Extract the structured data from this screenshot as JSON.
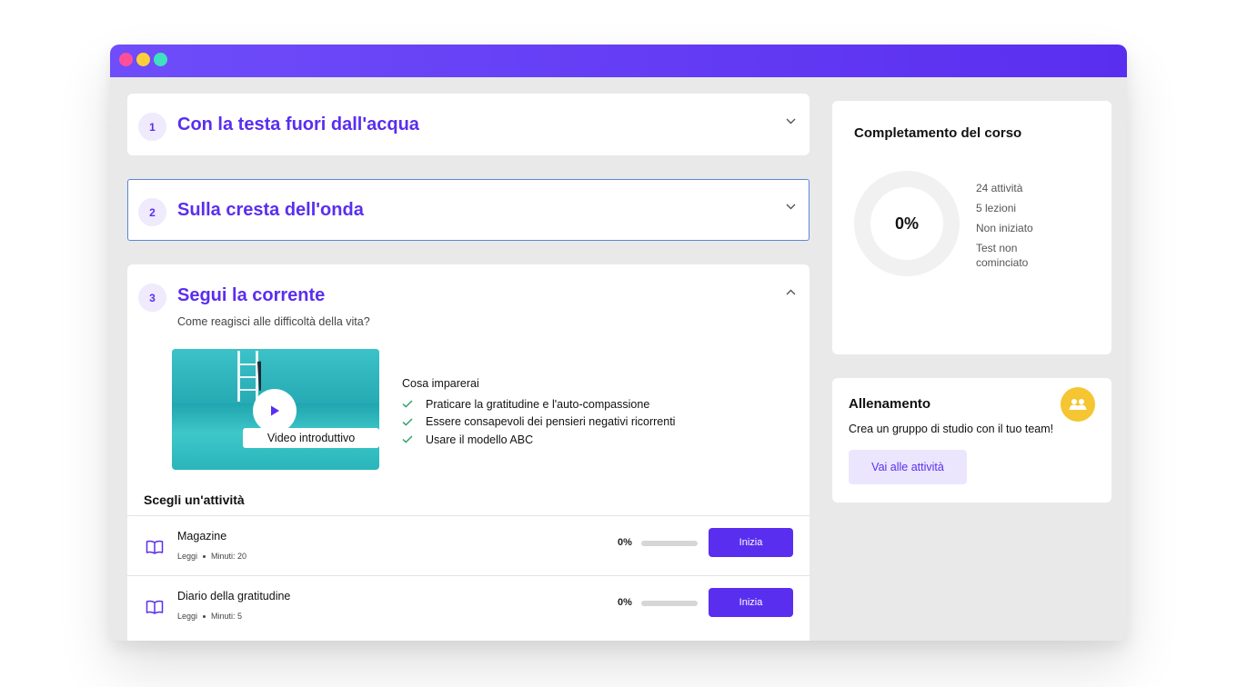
{
  "window": {
    "controls": [
      "close",
      "minimize",
      "maximize"
    ]
  },
  "modules": [
    {
      "number": "1",
      "title": "Con la testa fuori dall'acqua",
      "expanded": false
    },
    {
      "number": "2",
      "title": "Sulla cresta dell'onda",
      "expanded": false,
      "focused": true
    },
    {
      "number": "3",
      "title": "Segui la corrente",
      "subtitle": "Come reagisci alle difficoltà della vita?",
      "expanded": true
    }
  ],
  "video": {
    "caption": "Video introduttivo",
    "icon": "play-icon"
  },
  "learn": {
    "heading": "Cosa imparerai",
    "items": [
      "Praticare la gratitudine e l'auto-compassione",
      "Essere consapevoli dei pensieri negativi ricorrenti",
      "Usare il modello ABC"
    ]
  },
  "activities": {
    "heading": "Scegli un'attività",
    "items": [
      {
        "title": "Magazine",
        "type": "Leggi",
        "minutes": "Minuti: 20",
        "progress_label": "0%",
        "progress": 0,
        "button": "Inizia",
        "icon": "book-icon"
      },
      {
        "title": "Diario della gratitudine",
        "type": "Leggi",
        "minutes": "Minuti: 5",
        "progress_label": "0%",
        "progress": 0,
        "button": "Inizia",
        "icon": "book-icon"
      }
    ]
  },
  "completion": {
    "title": "Completamento del corso",
    "percent_label": "0%",
    "percent": 0,
    "stats": [
      "24 attività",
      "5 lezioni",
      "Non iniziato",
      "Test non cominciato"
    ]
  },
  "training": {
    "title": "Allenamento",
    "description": "Crea un gruppo di studio con il tuo team!",
    "button": "Vai alle attività",
    "icon": "group-icon"
  },
  "colors": {
    "accent": "#5a2eef",
    "accent_light": "#efeafc",
    "badge": "#f5c532",
    "check": "#2fa36b"
  }
}
